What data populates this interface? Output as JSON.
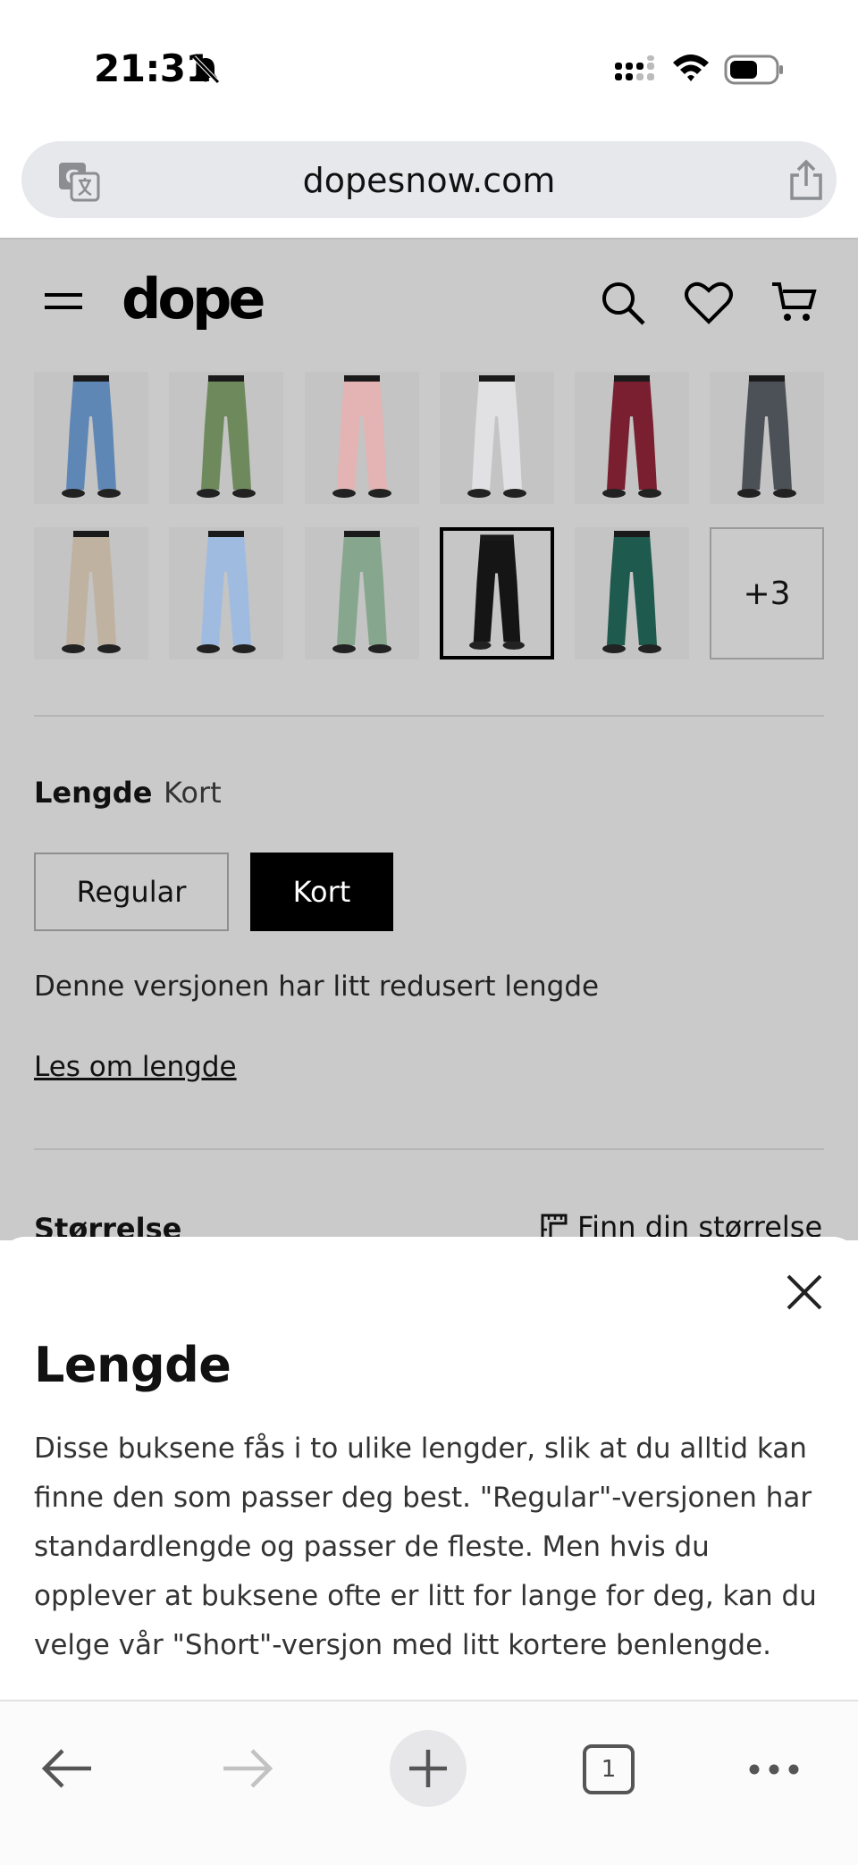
{
  "status_bar": {
    "time": "21:31"
  },
  "browser": {
    "url": "dopesnow.com",
    "open_tabs": "1"
  },
  "site": {
    "logo": "dope",
    "variants_more_label": "+3",
    "swatch_colors": [
      "#5f87b6",
      "#6e8a5c",
      "#e3b4b3",
      "#e1e1e3",
      "#7a1f2f",
      "#4c5157",
      "#bfb2a0",
      "#9fbce0",
      "#86a68d",
      "#151515",
      "#1f5a4e"
    ],
    "length": {
      "label": "Lengde",
      "selected_value": "Kort",
      "options": [
        {
          "label": "Regular",
          "selected": false
        },
        {
          "label": "Kort",
          "selected": true
        }
      ],
      "description": "Denne versjonen har litt redusert lengde",
      "link": "Les om lengde"
    },
    "size": {
      "label": "Størrelse",
      "guide_link": "Finn din størrelse"
    }
  },
  "sheet": {
    "title": "Lengde",
    "body": "Disse buksene fås i to ulike lengder, slik at du alltid kan finne den som passer deg best. \"Regular\"-versjonen har standardlengde og passer de fleste. Men hvis du opplever at buksene ofte er litt for lange for deg, kan du velge vår \"Short\"-versjon med litt kortere benlengde."
  }
}
